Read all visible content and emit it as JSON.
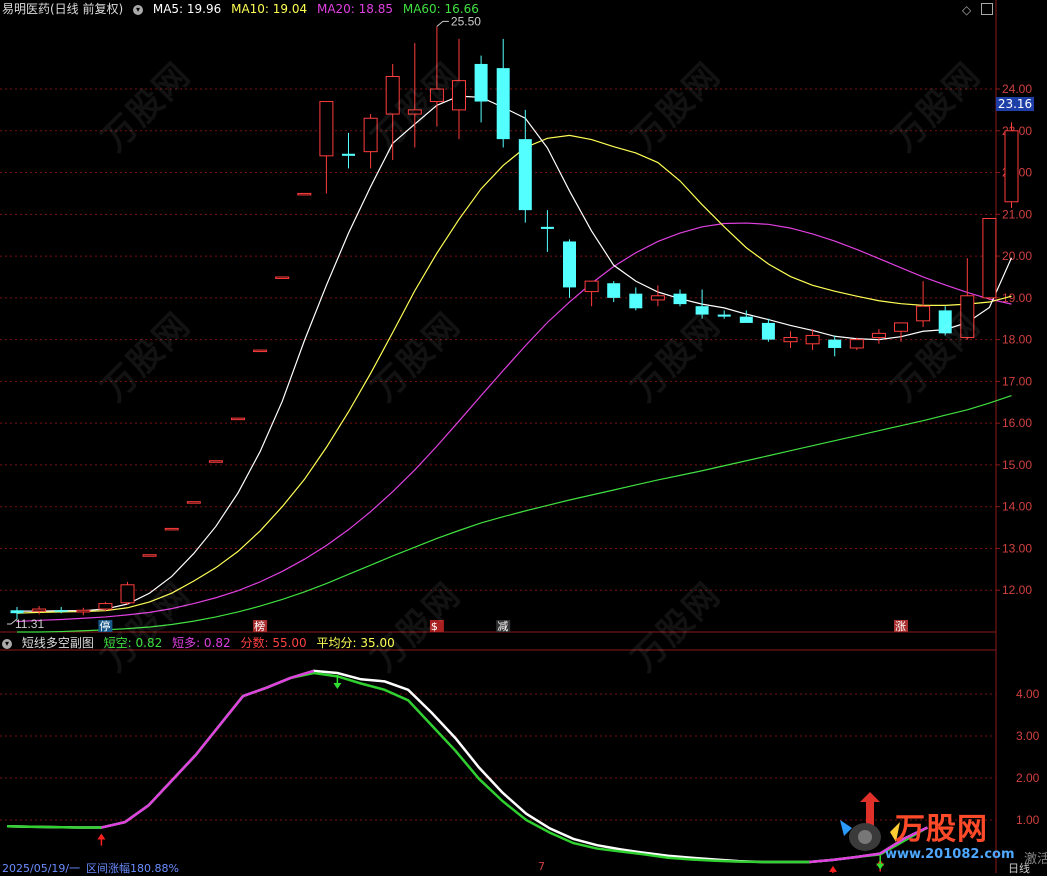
{
  "stock": {
    "title": "易明医药(日线 前复权)",
    "ma5_label": "MA5: 19.96",
    "ma10_label": "MA10: 19.04",
    "ma20_label": "MA20: 18.85",
    "ma60_label": "MA60: 16.66",
    "high_annot": "25.50",
    "low_annot": "11.31",
    "current_price": "23.16"
  },
  "colors": {
    "bg": "#000000",
    "up": "#ff3d3d",
    "down": "#54ffff",
    "ma5": "#ffffff",
    "ma10": "#ffff55",
    "ma20": "#e040e0",
    "ma60": "#40e040",
    "grid": "#7a1010",
    "axis_text": "#d04040"
  },
  "sub": {
    "title": "短线多空副图",
    "short_label": "短空: 0.82",
    "long_label": "短多: 0.82",
    "score_label": "分数: 55.00",
    "avg_label": "平均分: 35.00"
  },
  "event_tags": [
    "停",
    "榜",
    "$",
    "减",
    "涨"
  ],
  "bottom": {
    "date_text": "2025/05/19/一",
    "range_text": "区间涨幅180.88%",
    "mid_mark": "7",
    "side_text": "日线",
    "activate_text": "激活"
  },
  "watermark": {
    "brand": "万股网",
    "url": "www.201082.com"
  },
  "chart_data": {
    "type": "candlestick",
    "title": "易明医药(日线 前复权)",
    "ylim": [
      11.0,
      25.7
    ],
    "ticks": [
      12.0,
      13.0,
      14.0,
      15.0,
      16.0,
      17.0,
      18.0,
      19.0,
      20.0,
      21.0,
      22.0,
      23.0,
      24.0
    ],
    "tick_labels": [
      "12.00",
      "13.00",
      "14.00",
      "15.00",
      "16.00",
      "17.00",
      "18.00",
      "19.00",
      "20.00",
      "21.00",
      "22.00",
      "23.00",
      "24.00"
    ],
    "candles": [
      {
        "o": 11.52,
        "h": 11.6,
        "l": 11.31,
        "c": 11.45
      },
      {
        "o": 11.5,
        "h": 11.62,
        "l": 11.42,
        "c": 11.55
      },
      {
        "o": 11.52,
        "h": 11.6,
        "l": 11.45,
        "c": 11.5
      },
      {
        "o": 11.48,
        "h": 11.58,
        "l": 11.4,
        "c": 11.52
      },
      {
        "o": 11.55,
        "h": 11.72,
        "l": 11.5,
        "c": 11.68
      },
      {
        "o": 11.7,
        "h": 12.2,
        "l": 11.65,
        "c": 12.13
      },
      {
        "o": 12.85,
        "h": 12.85,
        "l": 12.85,
        "c": 12.85
      },
      {
        "o": 13.48,
        "h": 13.48,
        "l": 13.48,
        "c": 13.48
      },
      {
        "o": 14.12,
        "h": 14.12,
        "l": 14.12,
        "c": 14.12
      },
      {
        "o": 15.1,
        "h": 15.1,
        "l": 15.1,
        "c": 15.1
      },
      {
        "o": 16.12,
        "h": 16.12,
        "l": 16.12,
        "c": 16.12
      },
      {
        "o": 17.75,
        "h": 17.75,
        "l": 17.75,
        "c": 17.75
      },
      {
        "o": 19.5,
        "h": 19.5,
        "l": 19.5,
        "c": 19.5
      },
      {
        "o": 21.5,
        "h": 21.5,
        "l": 21.5,
        "c": 21.5
      },
      {
        "o": 22.4,
        "h": 23.7,
        "l": 21.5,
        "c": 23.7
      },
      {
        "o": 22.45,
        "h": 22.95,
        "l": 22.1,
        "c": 22.4
      },
      {
        "o": 22.5,
        "h": 23.4,
        "l": 22.1,
        "c": 23.3
      },
      {
        "o": 23.4,
        "h": 24.6,
        "l": 22.3,
        "c": 24.3
      },
      {
        "o": 23.4,
        "h": 25.1,
        "l": 22.6,
        "c": 23.5
      },
      {
        "o": 23.7,
        "h": 25.5,
        "l": 23.1,
        "c": 24.0
      },
      {
        "o": 23.5,
        "h": 25.2,
        "l": 22.8,
        "c": 24.2
      },
      {
        "o": 24.6,
        "h": 24.8,
        "l": 23.2,
        "c": 23.7
      },
      {
        "o": 24.5,
        "h": 25.2,
        "l": 22.6,
        "c": 22.8
      },
      {
        "o": 22.8,
        "h": 23.5,
        "l": 20.8,
        "c": 21.1
      },
      {
        "o": 20.7,
        "h": 21.1,
        "l": 20.1,
        "c": 20.65
      },
      {
        "o": 20.35,
        "h": 20.4,
        "l": 19.0,
        "c": 19.25
      },
      {
        "o": 19.15,
        "h": 19.4,
        "l": 18.8,
        "c": 19.4
      },
      {
        "o": 19.35,
        "h": 19.4,
        "l": 18.9,
        "c": 19.0
      },
      {
        "o": 19.1,
        "h": 19.25,
        "l": 18.7,
        "c": 18.75
      },
      {
        "o": 18.95,
        "h": 19.3,
        "l": 18.8,
        "c": 19.05
      },
      {
        "o": 19.1,
        "h": 19.2,
        "l": 18.8,
        "c": 18.85
      },
      {
        "o": 18.8,
        "h": 19.2,
        "l": 18.5,
        "c": 18.6
      },
      {
        "o": 18.6,
        "h": 18.7,
        "l": 18.5,
        "c": 18.55
      },
      {
        "o": 18.55,
        "h": 18.7,
        "l": 18.4,
        "c": 18.4
      },
      {
        "o": 18.4,
        "h": 18.5,
        "l": 17.95,
        "c": 18.0
      },
      {
        "o": 17.95,
        "h": 18.2,
        "l": 17.8,
        "c": 18.05
      },
      {
        "o": 17.9,
        "h": 18.25,
        "l": 17.75,
        "c": 18.1
      },
      {
        "o": 18.0,
        "h": 18.1,
        "l": 17.6,
        "c": 17.8
      },
      {
        "o": 17.8,
        "h": 18.05,
        "l": 17.75,
        "c": 18.0
      },
      {
        "o": 18.05,
        "h": 18.25,
        "l": 17.9,
        "c": 18.15
      },
      {
        "o": 18.2,
        "h": 18.4,
        "l": 17.95,
        "c": 18.4
      },
      {
        "o": 18.45,
        "h": 19.4,
        "l": 18.3,
        "c": 18.8
      },
      {
        "o": 18.7,
        "h": 18.8,
        "l": 18.1,
        "c": 18.15
      },
      {
        "o": 18.05,
        "h": 19.95,
        "l": 18.0,
        "c": 19.05
      },
      {
        "o": 19.0,
        "h": 20.9,
        "l": 18.95,
        "c": 20.9
      },
      {
        "o": 21.3,
        "h": 23.2,
        "l": 21.15,
        "c": 23.0
      }
    ],
    "ma5": [
      11.5,
      11.5,
      11.51,
      11.51,
      11.55,
      11.67,
      11.93,
      12.33,
      12.88,
      13.53,
      14.33,
      15.32,
      16.52,
      17.97,
      19.3,
      20.55,
      21.66,
      22.7,
      23.16,
      23.61,
      23.83,
      23.8,
      23.56,
      23.3,
      22.59,
      21.56,
      20.6,
      19.78,
      19.4,
      19.14,
      18.98,
      18.85,
      18.76,
      18.61,
      18.48,
      18.34,
      18.22,
      18.08,
      18.02,
      18.0,
      18.07,
      18.2,
      18.24,
      18.41,
      18.77,
      19.96
    ],
    "ma10": [
      11.45,
      11.47,
      11.48,
      11.49,
      11.51,
      11.58,
      11.72,
      11.93,
      12.22,
      12.54,
      12.93,
      13.42,
      14.0,
      14.65,
      15.42,
      16.27,
      17.19,
      18.17,
      19.17,
      20.07,
      20.88,
      21.61,
      22.17,
      22.6,
      22.82,
      22.89,
      22.79,
      22.62,
      22.47,
      22.24,
      21.8,
      21.23,
      20.7,
      20.2,
      19.81,
      19.51,
      19.3,
      19.16,
      19.04,
      18.93,
      18.86,
      18.82,
      18.82,
      18.85,
      18.9,
      19.04
    ],
    "ma20": [
      11.25,
      11.28,
      11.3,
      11.33,
      11.36,
      11.41,
      11.47,
      11.56,
      11.68,
      11.82,
      11.99,
      12.2,
      12.45,
      12.74,
      13.07,
      13.45,
      13.88,
      14.36,
      14.88,
      15.45,
      16.05,
      16.66,
      17.26,
      17.85,
      18.41,
      18.9,
      19.35,
      19.75,
      20.08,
      20.35,
      20.55,
      20.7,
      20.78,
      20.79,
      20.76,
      20.67,
      20.53,
      20.36,
      20.16,
      19.94,
      19.72,
      19.5,
      19.31,
      19.13,
      18.97,
      18.85
    ],
    "ma60": [
      11.0,
      11.0,
      11.01,
      11.03,
      11.05,
      11.08,
      11.12,
      11.18,
      11.26,
      11.36,
      11.48,
      11.62,
      11.78,
      11.96,
      12.16,
      12.38,
      12.6,
      12.82,
      13.03,
      13.24,
      13.43,
      13.61,
      13.76,
      13.9,
      14.03,
      14.16,
      14.28,
      14.4,
      14.52,
      14.64,
      14.75,
      14.86,
      14.98,
      15.1,
      15.22,
      15.34,
      15.46,
      15.58,
      15.7,
      15.82,
      15.94,
      16.06,
      16.19,
      16.32,
      16.48,
      16.66
    ],
    "event_indices": [
      4,
      11,
      19,
      22,
      40
    ],
    "sub": {
      "ylim": [
        0.0,
        5.0
      ],
      "ticks": [
        1.0,
        2.0,
        3.0,
        4.0
      ],
      "tick_labels": [
        "1.00",
        "2.00",
        "3.00",
        "4.00"
      ],
      "line_white": [
        0.85,
        0.84,
        0.83,
        0.82,
        0.82,
        0.95,
        1.35,
        1.95,
        2.55,
        3.25,
        3.95,
        4.15,
        4.38,
        4.55,
        4.5,
        4.35,
        4.3,
        4.1,
        3.55,
        2.95,
        2.25,
        1.65,
        1.15,
        0.8,
        0.55,
        0.4,
        0.3,
        0.22,
        0.15,
        0.1,
        0.06,
        0.02,
        0.0,
        0.0,
        0.0,
        0.05,
        0.12,
        0.2,
        0.55,
        0.82
      ],
      "line_green": [
        0.85,
        0.84,
        0.83,
        0.82,
        0.82,
        0.95,
        1.35,
        1.95,
        2.55,
        3.25,
        3.95,
        4.15,
        4.38,
        4.5,
        4.42,
        4.25,
        4.1,
        3.85,
        3.25,
        2.65,
        1.98,
        1.45,
        1.0,
        0.7,
        0.45,
        0.32,
        0.25,
        0.18,
        0.1,
        0.06,
        0.03,
        0.01,
        0.0,
        0.0,
        0.0,
        0.05,
        0.12,
        0.18,
        0.5,
        0.82
      ],
      "buy_signals": [
        4,
        35,
        37
      ],
      "sell_signals": [
        14,
        37
      ]
    }
  }
}
